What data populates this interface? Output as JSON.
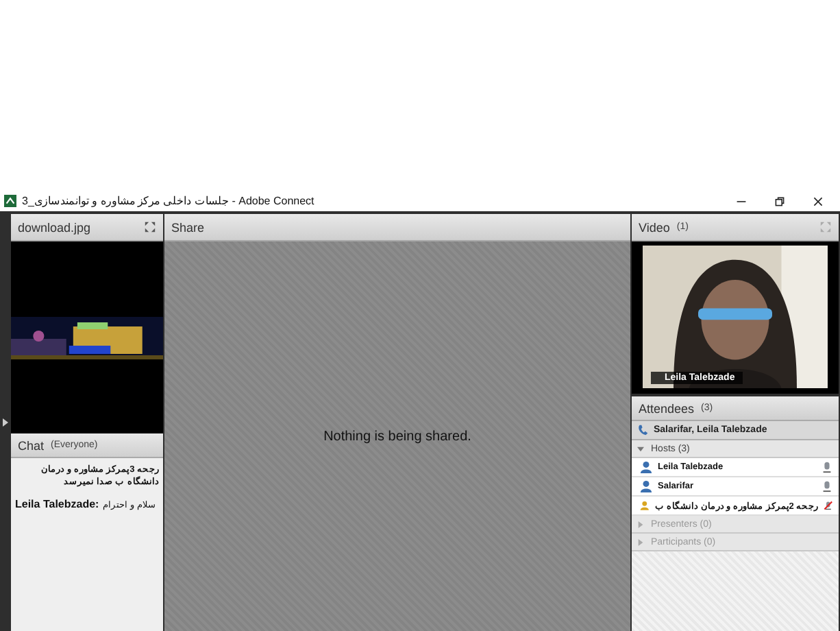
{
  "window": {
    "title": "جلسات داخلی مرکز مشاوره و توانمندسازی_3 - Adobe Connect"
  },
  "file_pod": {
    "title": "download.jpg"
  },
  "chat": {
    "title": "Chat",
    "scope": "(Everyone)",
    "messages": [
      {
        "text": "رجحه 3پمرکز مشاوره و درمان دانشگاه ب صدا نمیرسد"
      },
      {
        "sender": "Leila Talebzade:",
        "text": "سلام و احترام"
      }
    ]
  },
  "share": {
    "title": "Share",
    "message": "Nothing is being shared."
  },
  "video": {
    "title": "Video",
    "count": "(1)",
    "feeds": [
      {
        "name": "Leila Talebzade"
      }
    ]
  },
  "attendees": {
    "title": "Attendees",
    "count": "(3)",
    "speaking": "Salarifar, Leila Talebzade",
    "groups": [
      {
        "label": "Hosts (3)",
        "expanded": true,
        "members": [
          {
            "name": "Leila Talebzade",
            "color": "#3a6fb0",
            "muted": false
          },
          {
            "name": "Salarifar",
            "color": "#3a6fb0",
            "muted": false
          },
          {
            "name": "رجحه 2پمرکز مشاوره و درمان دانشگاه ب",
            "color": "#d9a520",
            "muted": true
          }
        ]
      },
      {
        "label": "Presenters (0)",
        "expanded": false
      },
      {
        "label": "Participants (0)",
        "expanded": false
      }
    ]
  }
}
